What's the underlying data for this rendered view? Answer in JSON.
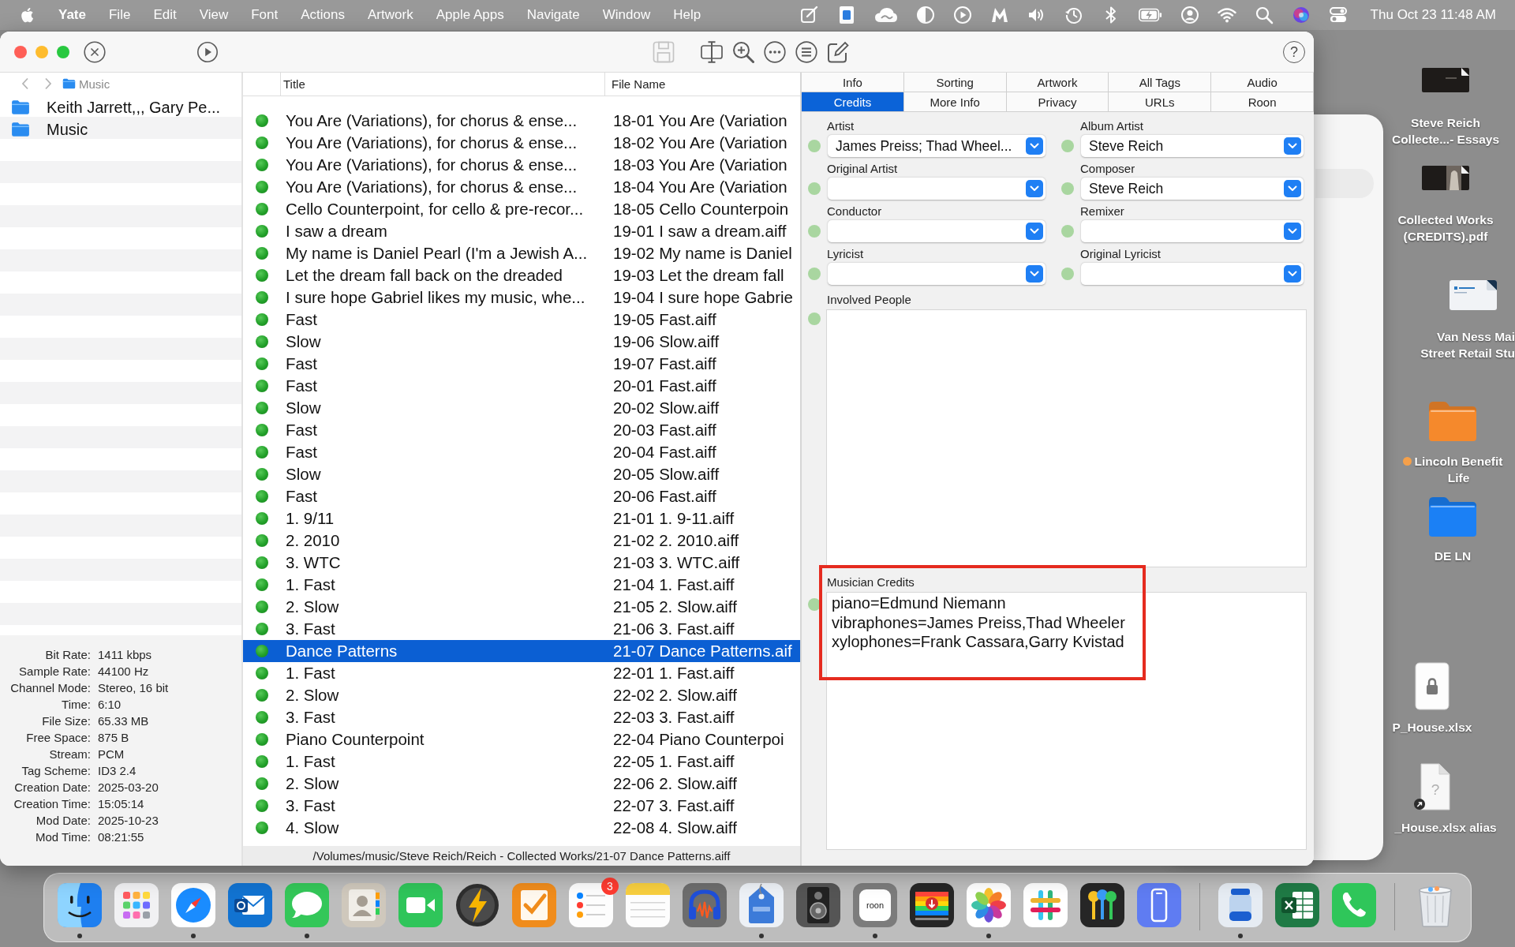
{
  "menu_bar": {
    "app_name": "Yate",
    "menus": [
      "File",
      "Edit",
      "View",
      "Font",
      "Actions",
      "Artwork",
      "Apple Apps",
      "Navigate",
      "Window",
      "Help"
    ],
    "clock": "Thu Oct 23 11:48 AM"
  },
  "toolbar": {
    "leading": [
      {
        "kind": "close-circle",
        "disabled": false
      },
      {
        "kind": "play-circle",
        "disabled": false
      }
    ],
    "tools": [
      {
        "kind": "save",
        "disabled": true
      },
      {
        "kind": "split",
        "disabled": false
      },
      {
        "kind": "zoom",
        "disabled": false
      },
      {
        "kind": "more",
        "disabled": false
      },
      {
        "kind": "list",
        "disabled": false
      },
      {
        "kind": "compose",
        "disabled": false
      }
    ],
    "help": "?"
  },
  "sidebar": {
    "path": "Music",
    "items": [
      {
        "label": "Keith Jarrett,,, Gary Pe...",
        "selected": false
      },
      {
        "label": "Music",
        "selected": false
      }
    ]
  },
  "file_info": [
    {
      "label": "Bit Rate:",
      "value": "1411 kbps"
    },
    {
      "label": "Sample Rate:",
      "value": "44100 Hz"
    },
    {
      "label": "Channel Mode:",
      "value": "Stereo, 16 bit"
    },
    {
      "label": "Time:",
      "value": "6:10"
    },
    {
      "label": "File Size:",
      "value": "65.33 MB"
    },
    {
      "label": "Free Space:",
      "value": "875 B"
    },
    {
      "label": "Stream:",
      "value": "PCM"
    },
    {
      "label": "Tag Scheme:",
      "value": "ID3 2.4"
    },
    {
      "label": "Creation Date:",
      "value": "2025-03-20"
    },
    {
      "label": "Creation Time:",
      "value": "15:05:14"
    },
    {
      "label": "Mod Date:",
      "value": "2025-10-23"
    },
    {
      "label": "Mod Time:",
      "value": "08:21:55"
    }
  ],
  "table": {
    "columns": [
      "Title",
      "File Name"
    ],
    "rows": [
      {
        "title": "You Are (Variations), for chorus & ense...",
        "file_name": "18-01 You Are (Variation",
        "selected": false
      },
      {
        "title": "You Are (Variations), for chorus & ense...",
        "file_name": "18-02 You Are (Variation",
        "selected": false
      },
      {
        "title": "You Are (Variations), for chorus & ense...",
        "file_name": "18-03 You Are (Variation",
        "selected": false
      },
      {
        "title": "You Are (Variations), for chorus & ense...",
        "file_name": "18-04 You Are (Variation",
        "selected": false
      },
      {
        "title": "Cello Counterpoint, for cello & pre-recor...",
        "file_name": "18-05 Cello Counterpoin",
        "selected": false
      },
      {
        "title": "I saw a dream",
        "file_name": "19-01 I saw a dream.aiff",
        "selected": false
      },
      {
        "title": "My name is Daniel Pearl (I'm a Jewish A...",
        "file_name": "19-02 My name is Daniel",
        "selected": false
      },
      {
        "title": "Let the dream fall back on the dreaded",
        "file_name": "19-03 Let the dream fall",
        "selected": false
      },
      {
        "title": "I sure hope Gabriel likes my music, whe...",
        "file_name": "19-04 I sure hope Gabrie",
        "selected": false
      },
      {
        "title": "Fast",
        "file_name": "19-05 Fast.aiff",
        "selected": false
      },
      {
        "title": "Slow",
        "file_name": "19-06 Slow.aiff",
        "selected": false
      },
      {
        "title": "Fast",
        "file_name": "19-07 Fast.aiff",
        "selected": false
      },
      {
        "title": "Fast",
        "file_name": "20-01 Fast.aiff",
        "selected": false
      },
      {
        "title": "Slow",
        "file_name": "20-02 Slow.aiff",
        "selected": false
      },
      {
        "title": "Fast",
        "file_name": "20-03 Fast.aiff",
        "selected": false
      },
      {
        "title": "Fast",
        "file_name": "20-04 Fast.aiff",
        "selected": false
      },
      {
        "title": "Slow",
        "file_name": "20-05 Slow.aiff",
        "selected": false
      },
      {
        "title": "Fast",
        "file_name": "20-06 Fast.aiff",
        "selected": false
      },
      {
        "title": "1. 9/11",
        "file_name": "21-01 1. 9-11.aiff",
        "selected": false
      },
      {
        "title": "2. 2010",
        "file_name": "21-02 2. 2010.aiff",
        "selected": false
      },
      {
        "title": "3. WTC",
        "file_name": "21-03 3. WTC.aiff",
        "selected": false
      },
      {
        "title": "1. Fast",
        "file_name": "21-04 1. Fast.aiff",
        "selected": false
      },
      {
        "title": "2. Slow",
        "file_name": "21-05 2. Slow.aiff",
        "selected": false
      },
      {
        "title": "3. Fast",
        "file_name": "21-06 3. Fast.aiff",
        "selected": false
      },
      {
        "title": "Dance Patterns",
        "file_name": "21-07 Dance Patterns.aif",
        "selected": true
      },
      {
        "title": "1. Fast",
        "file_name": "22-01 1. Fast.aiff",
        "selected": false
      },
      {
        "title": "2. Slow",
        "file_name": "22-02 2. Slow.aiff",
        "selected": false
      },
      {
        "title": "3. Fast",
        "file_name": "22-03 3. Fast.aiff",
        "selected": false
      },
      {
        "title": "Piano Counterpoint",
        "file_name": "22-04 Piano Counterpoi",
        "selected": false
      },
      {
        "title": "1. Fast",
        "file_name": "22-05 1. Fast.aiff",
        "selected": false
      },
      {
        "title": "2. Slow",
        "file_name": "22-06 2. Slow.aiff",
        "selected": false
      },
      {
        "title": "3. Fast",
        "file_name": "22-07 3. Fast.aiff",
        "selected": false
      },
      {
        "title": "4. Slow",
        "file_name": "22-08 4. Slow.aiff",
        "selected": false
      }
    ],
    "path": "/Volumes/music/Steve Reich/Reich - Collected Works/21-07 Dance Patterns.aiff"
  },
  "tag_panel": {
    "tab_rows": [
      [
        {
          "label": "Info",
          "selected": false
        },
        {
          "label": "Sorting",
          "selected": false
        },
        {
          "label": "Artwork",
          "selected": false
        },
        {
          "label": "All Tags",
          "selected": false
        },
        {
          "label": "Audio",
          "selected": false
        }
      ],
      [
        {
          "label": "Credits",
          "selected": true
        },
        {
          "label": "More Info",
          "selected": false
        },
        {
          "label": "Privacy",
          "selected": false
        },
        {
          "label": "URLs",
          "selected": false
        },
        {
          "label": "Roon",
          "selected": false
        }
      ]
    ],
    "fields": [
      {
        "label": "Artist",
        "value": "James Preiss; Thad Wheel..."
      },
      {
        "label": "Album Artist",
        "value": "Steve Reich"
      },
      {
        "label": "Original Artist"
      },
      {
        "label": "Composer",
        "value": "Steve Reich"
      },
      {
        "label": "Conductor"
      },
      {
        "label": "Remixer"
      },
      {
        "label": "Lyricist"
      },
      {
        "label": "Original Lyricist"
      }
    ],
    "involved_people": {
      "label": "Involved People"
    },
    "musician_credits": {
      "label": "Musician Credits",
      "lines": [
        "piano=Edmund Niemann",
        "vibraphones=James Preiss,Thad Wheeler",
        "xylophones=Frank Cassara,Garry Kvistad"
      ]
    }
  },
  "desktop": {
    "icons": [
      {
        "kind": "dark-thumbnail",
        "label": "Steve Reich\nCollecte...- Essays"
      },
      {
        "kind": "photo-thumbnail",
        "label": "Collected Works\n(CREDITS).pdf"
      },
      {
        "kind": "document",
        "label": "Van Ness Mai\nStreet Retail Stu"
      },
      {
        "kind": "folder",
        "color": "#f5892c",
        "tag": {
          "color": "#f5a04a"
        },
        "label": "Lincoln Benefit\nLife"
      },
      {
        "kind": "folder",
        "color": "#1b80f5",
        "label": "DE LN"
      },
      {
        "kind": "locked-file",
        "label": "P_House.xlsx"
      },
      {
        "kind": "alias-document",
        "glyph": "?",
        "label": "_House.xlsx alias"
      }
    ]
  },
  "dock": {
    "items": [
      {
        "kind": "smiling-face",
        "running": true
      },
      {
        "kind": "app-grid",
        "running": false
      },
      {
        "kind": "compass",
        "running": true
      },
      {
        "kind": "mail",
        "running": false
      },
      {
        "kind": "chat-bubble",
        "running": true
      },
      {
        "kind": "contact-card",
        "running": false
      },
      {
        "kind": "video-camera",
        "running": false
      },
      {
        "kind": "lightning",
        "running": false
      },
      {
        "kind": "checkmark",
        "running": false
      },
      {
        "kind": "reminders-list",
        "running": false,
        "badge": "3"
      },
      {
        "kind": "notepad",
        "running": false
      },
      {
        "kind": "headphones",
        "running": false
      },
      {
        "kind": "tag",
        "running": true
      },
      {
        "kind": "speaker",
        "running": false
      },
      {
        "kind": "logo-text",
        "running": true,
        "glyph": "roon"
      },
      {
        "kind": "screen",
        "running": false
      },
      {
        "kind": "flower",
        "running": true
      },
      {
        "kind": "hash",
        "running": false
      },
      {
        "kind": "keys",
        "running": false
      },
      {
        "kind": "phone-screen",
        "running": false
      },
      {
        "kind": "separator"
      },
      {
        "kind": "jar",
        "running": true
      },
      {
        "kind": "spreadsheet",
        "running": false
      },
      {
        "kind": "phone",
        "running": false
      },
      {
        "kind": "separator"
      },
      {
        "kind": "trash",
        "running": false
      }
    ]
  }
}
